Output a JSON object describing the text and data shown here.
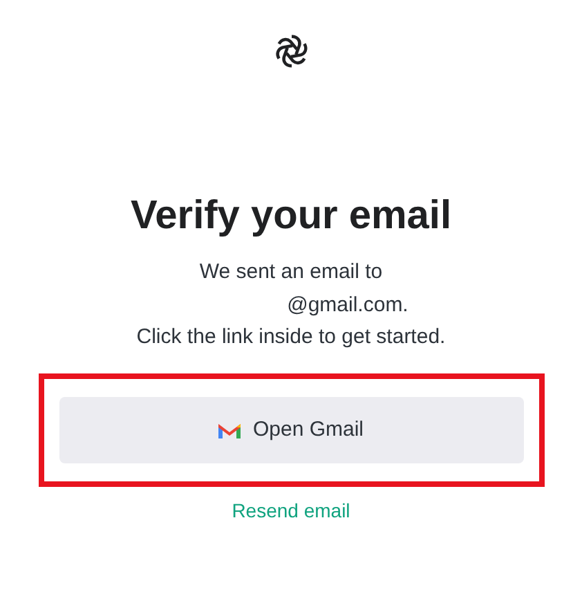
{
  "heading": "Verify your email",
  "message_lines": [
    "We sent an email to",
    "@gmail.com.",
    "Click the link inside to get started."
  ],
  "highlighted": true,
  "open_button": {
    "label": "Open Gmail"
  },
  "resend_link": "Resend email"
}
